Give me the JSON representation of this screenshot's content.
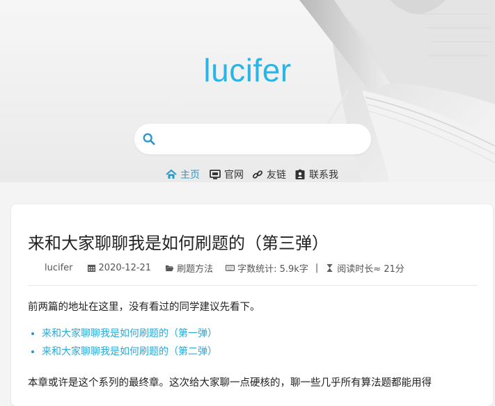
{
  "site": {
    "logo": "lucifer",
    "search": {
      "placeholder": "",
      "value": ""
    },
    "nav": [
      {
        "label": "主页",
        "icon": "home-icon",
        "active": true
      },
      {
        "label": "官网",
        "icon": "monitor-icon",
        "active": false
      },
      {
        "label": "友链",
        "icon": "link-icon",
        "active": false
      },
      {
        "label": "联系我",
        "icon": "contact-card-icon",
        "active": false
      }
    ]
  },
  "post": {
    "title": "来和大家聊聊我是如何刷题的（第三弹）",
    "meta": {
      "author": "lucifer",
      "date": "2020-12-21",
      "category": "刷题方法",
      "word_count": "字数统计: 5.9k字",
      "separator": "|",
      "read_time": "阅读时长≈ 21分"
    },
    "intro": "前两篇的地址在这里，没有看过的同学建议先看下。",
    "links": [
      "来和大家聊聊我是如何刷题的（第一弹）",
      "来和大家聊聊我是如何刷题的（第二弹）"
    ],
    "para2": "本章或许是这个系列的最终章。这次给大家聊一点硬核的，聊一些几乎所有算法题都能用得"
  },
  "colors": {
    "accent": "#29b6e6",
    "link": "#2aa9d6",
    "nav_active": "#2a98c8"
  }
}
